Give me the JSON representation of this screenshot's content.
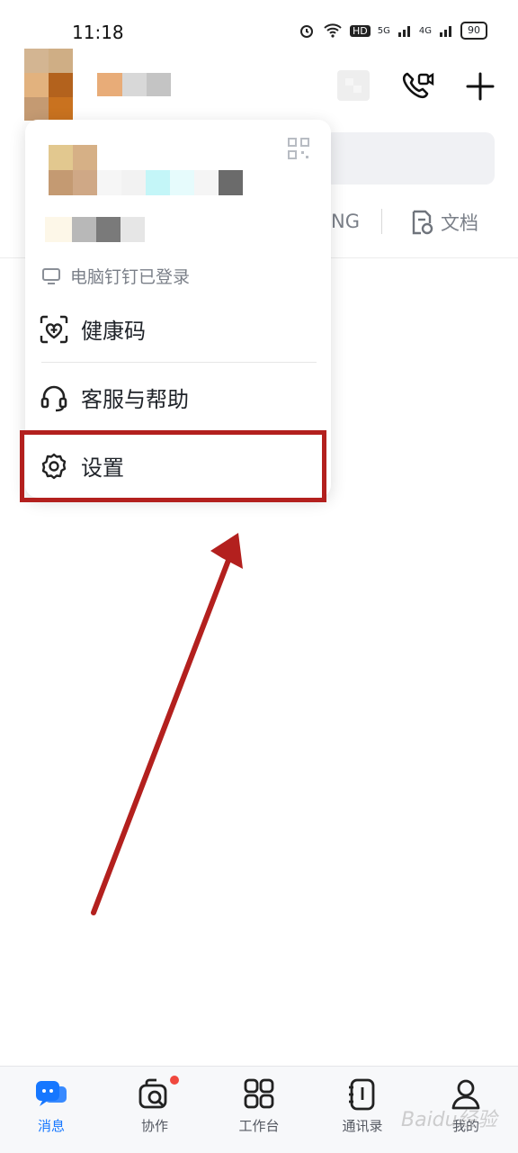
{
  "status_bar": {
    "time": "11:18",
    "battery": "90",
    "hd_label": "HD",
    "net_5g": "5G",
    "net_4g": "4G"
  },
  "header": {
    "icons": [
      "avatar-pixelated",
      "call-icon",
      "add-icon"
    ]
  },
  "tabs": {
    "partial_tab": "NG",
    "docs_tab": "文档"
  },
  "popup": {
    "login_status": "电脑钉钉已登录",
    "items": [
      {
        "label": "健康码",
        "icon": "health-code-icon"
      },
      {
        "label": "客服与帮助",
        "icon": "headset-icon"
      },
      {
        "label": "设置",
        "icon": "gear-icon"
      }
    ]
  },
  "bottom_nav": [
    {
      "label": "消息",
      "icon": "message-icon",
      "active": true
    },
    {
      "label": "协作",
      "icon": "collab-icon",
      "active": false,
      "badge": true
    },
    {
      "label": "工作台",
      "icon": "workbench-icon",
      "active": false
    },
    {
      "label": "通讯录",
      "icon": "contacts-icon",
      "active": false
    },
    {
      "label": "我的",
      "icon": "profile-icon",
      "active": false
    }
  ],
  "watermark": "Baidu经验",
  "colors": {
    "accent": "#1677ff",
    "highlight": "#b3201e",
    "badge": "#f0483e"
  }
}
